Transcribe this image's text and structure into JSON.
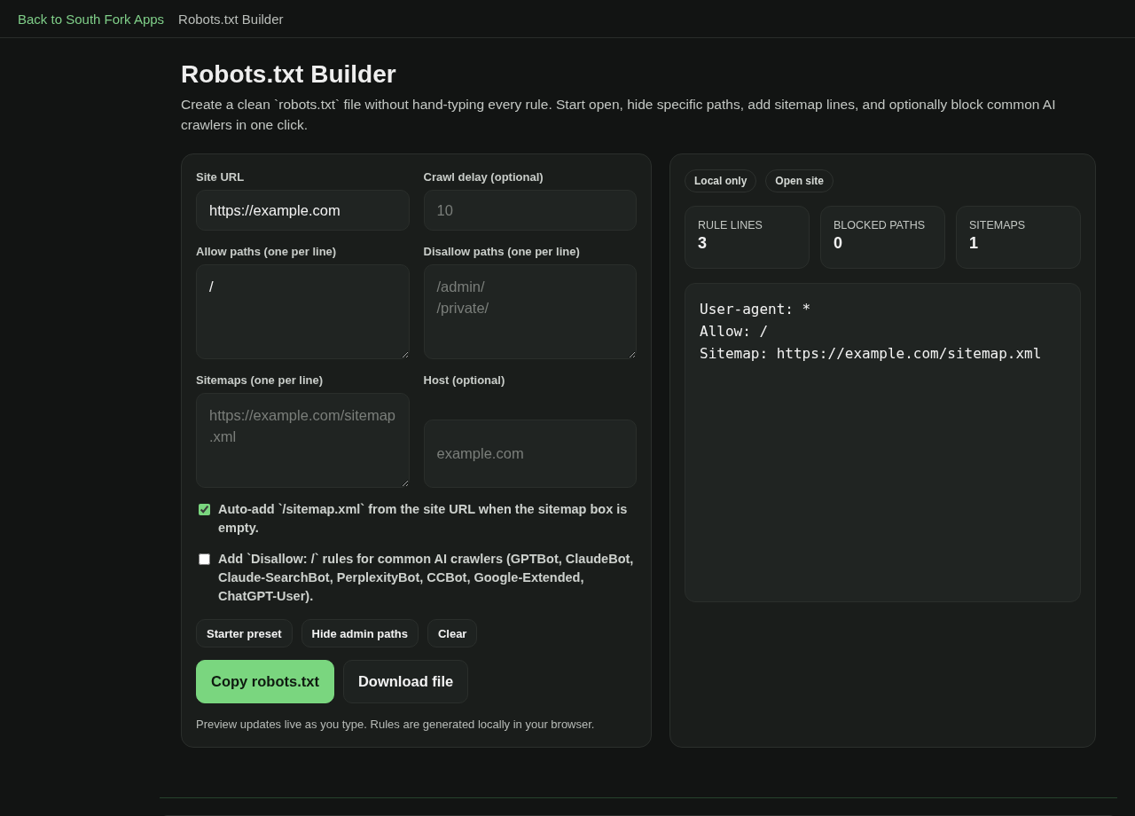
{
  "top_bar": {
    "back_link": "Back to South Fork Apps",
    "page_name": "Robots.txt Builder"
  },
  "header": {
    "title": "Robots.txt Builder",
    "description": "Create a clean `robots.txt` file without hand-typing every rule. Start open, hide specific paths, add sitemap lines, and optionally block common AI crawlers in one click."
  },
  "form": {
    "fields": [
      {
        "label": "Site URL",
        "kind": "input",
        "value": "https://example.com"
      },
      {
        "label": "Crawl delay (optional)",
        "kind": "input",
        "placeholder": "10"
      },
      {
        "label": "Allow paths (one per line)",
        "kind": "textarea",
        "value": "/"
      },
      {
        "label": "Disallow paths (one per line)",
        "kind": "textarea",
        "placeholder": "/admin/\n/private/"
      },
      {
        "label": "Sitemaps (one per line)",
        "kind": "textarea",
        "placeholder": "https://example.com/sitemap.xml"
      },
      {
        "label": "Host (optional)",
        "kind": "input",
        "placeholder": "example.com"
      }
    ],
    "options": [
      {
        "label": "Auto-add `/sitemap.xml` from the site URL when the sitemap box is empty.",
        "checked": true
      },
      {
        "label": "Add `Disallow: /` rules for common AI crawlers (GPTBot, ClaudeBot, Claude-SearchBot, PerplexityBot, CCBot, Google-Extended, ChatGPT-User).",
        "checked": false
      }
    ],
    "preset_buttons": [
      "Starter preset",
      "Hide admin paths",
      "Clear"
    ],
    "actions": [
      {
        "label": "Copy robots.txt",
        "kind": "primary"
      },
      {
        "label": "Download file",
        "kind": "secondary"
      }
    ],
    "note": "Preview updates live as you type. Rules are generated locally in your browser."
  },
  "preview": {
    "badges": [
      "Local only",
      "Open site"
    ],
    "stats": [
      {
        "label": "RULE LINES",
        "value": "3"
      },
      {
        "label": "BLOCKED PATHS",
        "value": "0"
      },
      {
        "label": "SITEMAPS",
        "value": "1"
      }
    ],
    "output": "User-agent: *\nAllow: /\nSitemap: https://example.com/sitemap.xml"
  }
}
